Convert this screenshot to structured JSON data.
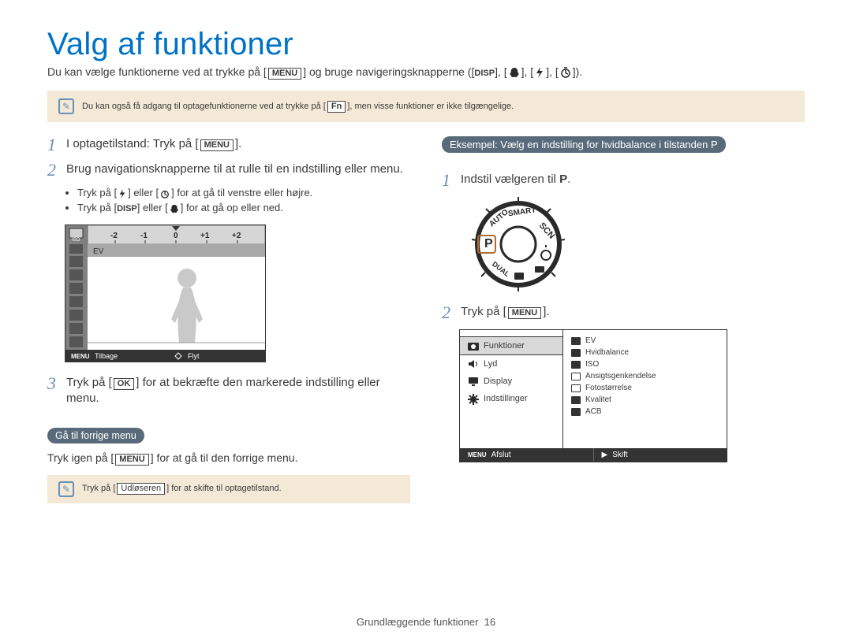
{
  "title": "Valg af funktioner",
  "intro_pre": "Du kan vælge funktionerne ved at trykke på [",
  "intro_menu": "MENU",
  "intro_mid": "] og bruge navigeringsknapperne ([",
  "intro_disp": "DISP",
  "intro_end": ").",
  "note1_pre": "Du kan også få adgang til optagefunktionerne ved at trykke på [",
  "note1_fn": "Fn",
  "note1_post": "], men visse funktioner er ikke tilgængelige.",
  "steps_left": {
    "s1_pre": "I optagetilstand: Tryk på [",
    "s1_btn": "MENU",
    "s1_post": "].",
    "s2": "Brug navigationsknapperne til at rulle til en indstilling eller menu.",
    "b1": "Tryk på [      ] eller [      ] for at gå til venstre eller højre.",
    "b2_pre": "Tryk på [",
    "b2_disp": "DISP",
    "b2_mid": "] eller [      ] for at gå op eller ned.",
    "s3_pre": "Tryk på [",
    "s3_btn": "OK",
    "s3_post": "] for at bekræfte den markerede indstilling eller menu."
  },
  "left_shot": {
    "ev": "EV",
    "scale": [
      "-2",
      "-1",
      "0",
      "+1",
      "+2"
    ],
    "back_key": "MENU",
    "back": "Tilbage",
    "move": "Flyt"
  },
  "back_heading": "Gå til forrige menu",
  "back_text_pre": "Tryk igen på [",
  "back_text_btn": "MENU",
  "back_text_post": "] for at gå til den forrige menu.",
  "note2_pre": "Tryk på [",
  "note2_btn": "Udløseren",
  "note2_post": "] for at skifte til optagetilstand.",
  "example_heading": "Eksempel: Vælg en indstilling for hvidbalance i tilstanden P",
  "steps_right": {
    "s1": "Indstil vælgeren til ",
    "s1_mode": "P",
    "s2_pre": "Tryk på [",
    "s2_btn": "MENU",
    "s2_post": "]."
  },
  "menu": {
    "left": [
      "Funktioner",
      "Lyd",
      "Display",
      "Indstillinger"
    ],
    "right": [
      "EV",
      "Hvidbalance",
      "ISO",
      "Ansigtsgenkendelse",
      "Fotostørrelse",
      "Kvalitet",
      "ACB"
    ],
    "bar_exit_key": "MENU",
    "bar_exit": "Afslut",
    "bar_shift": "Skift"
  },
  "footer_label": "Grundlæggende funktioner",
  "footer_page": "16"
}
